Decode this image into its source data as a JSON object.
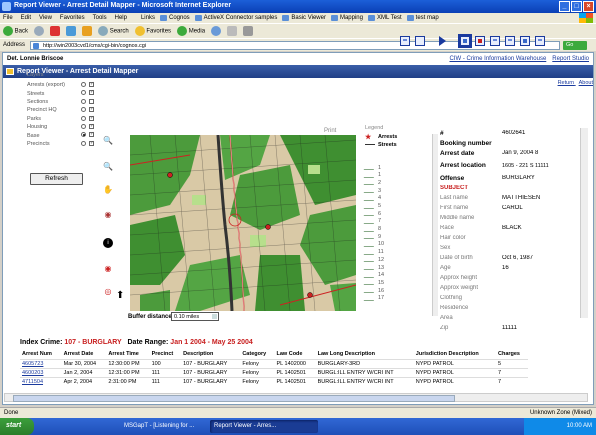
{
  "window": {
    "title": "Report Viewer - Arrest Detail Mapper - Microsoft Internet Explorer",
    "controls": [
      "_",
      "□",
      "×"
    ]
  },
  "menu": {
    "items": [
      "File",
      "Edit",
      "View",
      "Favorites",
      "Tools",
      "Help"
    ],
    "links_label": "Links",
    "links": [
      "Cognos",
      "ActiveX Connector samples",
      "Basic Viewer",
      "Mapping",
      "XML Test",
      "test map"
    ]
  },
  "toolbar": {
    "back": "Back",
    "search": "Search",
    "favorites": "Favorites",
    "media": "Media"
  },
  "address": {
    "label": "Address",
    "url": "http://win2003cvd1/cms/cgi-bin/cognos.cgi",
    "go": "Go"
  },
  "page": {
    "owner": "Det. Lonnie Briscoe",
    "portal_link_1": "CIW - Crime Information Warehouse",
    "portal_link_2": "Report Studio",
    "header": "Report Viewer - Arrest Detail Mapper",
    "return_link": "Return",
    "about_link": "About"
  },
  "layers": {
    "title": "Layers",
    "items": [
      {
        "label": "Arrests (export)",
        "radio": false,
        "checked": true
      },
      {
        "label": "Streets",
        "radio": false,
        "checked": true
      },
      {
        "label": "Sections",
        "radio": false,
        "checked": false
      },
      {
        "label": "Precinct HQ",
        "radio": false,
        "checked": true
      },
      {
        "label": "Parks",
        "radio": false,
        "checked": true
      },
      {
        "label": "Housing",
        "radio": false,
        "checked": true
      },
      {
        "label": "Base",
        "radio": true,
        "checked": true
      },
      {
        "label": "Precincts",
        "radio": false,
        "checked": true
      }
    ],
    "refresh": "Refresh"
  },
  "map": {
    "print_label": "Print",
    "buffer_label": "Buffer distances",
    "buffer_value": "0.10 miles"
  },
  "legend": {
    "title": "Legend",
    "items": [
      {
        "label": "Arrests",
        "bold": true
      },
      {
        "label": "Streets",
        "bold": true
      },
      {
        "label": "",
        "bold": false
      },
      {
        "label": "",
        "bold": false
      },
      {
        "label": "1",
        "bold": false
      },
      {
        "label": "1",
        "bold": false
      },
      {
        "label": "2",
        "bold": false
      },
      {
        "label": "3",
        "bold": false
      },
      {
        "label": "4",
        "bold": false
      },
      {
        "label": "5",
        "bold": false
      },
      {
        "label": "6",
        "bold": false
      },
      {
        "label": "7",
        "bold": false
      },
      {
        "label": "8",
        "bold": false
      },
      {
        "label": "9",
        "bold": false
      },
      {
        "label": "10",
        "bold": false
      },
      {
        "label": "11",
        "bold": false
      },
      {
        "label": "12",
        "bold": false
      },
      {
        "label": "13",
        "bold": false
      },
      {
        "label": "14",
        "bold": false
      },
      {
        "label": "15",
        "bold": false
      },
      {
        "label": "16",
        "bold": false
      },
      {
        "label": "17",
        "bold": false
      }
    ]
  },
  "details": {
    "rows": [
      {
        "k": "#",
        "v": "4602641",
        "style": "h"
      },
      {
        "k": "Booking number",
        "v": "",
        "style": "h"
      },
      {
        "k": "Arrest date",
        "v": "Jan 9, 2004 8",
        "style": "h"
      },
      {
        "k": "Arrest location",
        "v": "1605 - 221 S 11111",
        "style": "h tall"
      },
      {
        "k": "Offense",
        "v": "BURGLARY",
        "style": "h"
      },
      {
        "k": "SUBJECT",
        "v": "",
        "style": "red"
      },
      {
        "k": "Last name",
        "v": "MATTHIESEN",
        "style": ""
      },
      {
        "k": "First name",
        "v": "CAROL",
        "style": ""
      },
      {
        "k": "Middle name",
        "v": "",
        "style": ""
      },
      {
        "k": "Race",
        "v": "BLACK",
        "style": ""
      },
      {
        "k": "Hair color",
        "v": "",
        "style": ""
      },
      {
        "k": "Sex",
        "v": "",
        "style": ""
      },
      {
        "k": "Date of birth",
        "v": "Oct 6, 1987",
        "style": ""
      },
      {
        "k": "Age",
        "v": "16",
        "style": ""
      },
      {
        "k": "Approx height",
        "v": "",
        "style": ""
      },
      {
        "k": "Approx weight",
        "v": "",
        "style": ""
      },
      {
        "k": "Clothing",
        "v": "",
        "style": ""
      },
      {
        "k": "Residence",
        "v": "",
        "style": ""
      },
      {
        "k": "Area",
        "v": "",
        "style": ""
      },
      {
        "k": "Zip",
        "v": "11111",
        "style": ""
      }
    ]
  },
  "index": {
    "label": "Index Crime:",
    "crime": "107 - BURGLARY",
    "range_label": "Date Range:",
    "range": "Jan 1 2004 - May 25 2004"
  },
  "table": {
    "headers": [
      "Arrest Num",
      "Arrest Date",
      "Arrest Time",
      "Precinct",
      "Description",
      "Category",
      "Law Code",
      "Law Long Description",
      "Jurisdiction Description",
      "Charges"
    ],
    "rows": [
      [
        "4605723",
        "Mar 30, 2004",
        "12:30:00 PM",
        "100",
        "107 - BURGLARY",
        "Felony",
        "PL 1402000",
        "BURGLARY-3RD",
        "NYPD PATROL",
        "5"
      ],
      [
        "4600203",
        "Jan 2, 2004",
        "12:31:00 PM",
        "111",
        "107 - BURGLARY",
        "Felony",
        "PL 1402501",
        "BURGL:ILL ENTRY W/CRI INT",
        "NYPD PATROL",
        "7"
      ],
      [
        "4711504",
        "Apr 2, 2004",
        "2:31:00 PM",
        "111",
        "107 - BURGLARY",
        "Felony",
        "PL 1402501",
        "BURGL:ILL ENTRY W/CRI INT",
        "NYPD PATROL",
        "7"
      ]
    ]
  },
  "status": {
    "left": "Done",
    "zone": "Unknown Zone (Mixed)"
  },
  "taskbar": {
    "start": "start",
    "tasks": [
      "MSGapT - [Listening for ...",
      "Report Viewer - Arres..."
    ],
    "clock": "10:00 AM"
  }
}
